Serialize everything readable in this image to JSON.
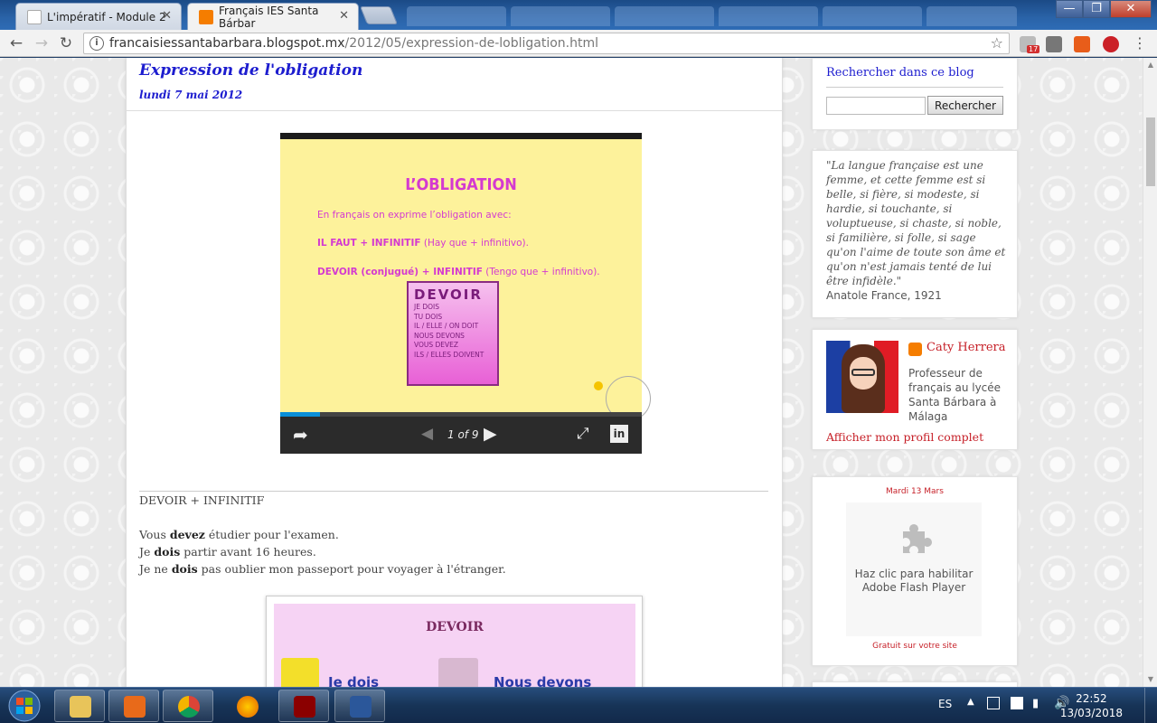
{
  "browser": {
    "tabs": [
      {
        "title": "L'impératif - Module 2",
        "close": "✕"
      },
      {
        "title": "Français IES Santa Bárbar",
        "close": "✕"
      }
    ],
    "window_buttons": {
      "minimize": "—",
      "maximize": "❐",
      "close": "✕"
    },
    "nav": {
      "back": "←",
      "forward": "→",
      "reload": "↻"
    },
    "url": {
      "domain": "francaisiessantabarbara.blogspot.mx",
      "path": "/2012/05/expression-de-lobligation.html"
    },
    "extension_badge": "17"
  },
  "post": {
    "title": "Expression de l'obligation",
    "date": "lundi 7 mai 2012",
    "slideshow": {
      "slide_title": "L’OBLIGATION",
      "line1": "En français  on exprime l’obligation avec:",
      "line2_bold": "IL FAUT + INFINITIF",
      "line2_rest": "  (Hay que + infinitivo).",
      "line3_bold": "DEVOIR (conjugué) + INFINITIF",
      "line3_rest": " (Tengo que + infinitivo).",
      "card_title": "DEVOIR",
      "card_lines": [
        "JE DOIS",
        "TU DOIS",
        "IL / ELLE / ON DOIT",
        "NOUS DEVONS",
        "VOUS DEVEZ",
        "ILS / ELLES DOIVENT"
      ],
      "counter": "1 of 9",
      "progress": 0.11
    },
    "section_heading": "DEVOIR + INFINITIF",
    "sentences": [
      {
        "pre": "Vous ",
        "verb": "devez",
        "post": " étudier pour l'examen."
      },
      {
        "pre": "Je ",
        "verb": "dois",
        "post": " partir avant 16 heures."
      },
      {
        "pre": "Je ne ",
        "verb": "dois",
        "post": " pas oublier mon passeport pour voyager à l'étranger."
      }
    ],
    "image2": {
      "title": "DEVOIR",
      "word1": "Je dois",
      "word2": "Nous devons"
    }
  },
  "sidebar": {
    "search": {
      "heading": "Rechercher dans ce blog",
      "button": "Rechercher",
      "placeholder": ""
    },
    "quote": {
      "text": "\"La langue française est une femme, et cette femme est si belle, si fière, si modeste, si hardie, si touchante, si voluptueuse, si chaste, si noble, si familière, si folle, si sage qu'on l'aime de toute son âme et qu'on n'est jamais tenté de lui être infidèle.\"",
      "author": "Anatole France, 1921"
    },
    "profile": {
      "name": "Caty Herrera",
      "description": "Professeur de français au lycée Santa Bárbara à Málaga",
      "link": "Afficher mon profil complet"
    },
    "flash": {
      "date": "Mardi 13 Mars",
      "message": "Haz clic para habilitar Adobe Flash Player",
      "footer": "Gratuit sur votre site"
    }
  },
  "taskbar": {
    "language": "ES",
    "time": "22:52",
    "date": "13/03/2018"
  },
  "colors": {
    "title_blue": "#1d1dcf",
    "link_red": "#c61f27",
    "slide_pink": "#d43ad0",
    "slide_bg": "#fdf29b"
  }
}
